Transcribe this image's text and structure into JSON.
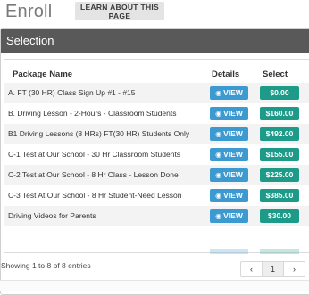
{
  "page": {
    "title": "Enroll",
    "learn_label": "LEARN ABOUT THIS PAGE"
  },
  "panel": {
    "title": "Selection"
  },
  "table": {
    "headers": {
      "name": "Package Name",
      "details": "Details",
      "select": "Select"
    },
    "view_label": "VIEW",
    "rows": [
      {
        "name": "A. FT (30 HR) Class Sign Up #1 - #15",
        "price": "$0.00"
      },
      {
        "name": "B. Driving Lesson - 2-Hours - Classroom Students",
        "price": "$160.00"
      },
      {
        "name": "B1 Driving Lessons (8 HRs) FT(30 HR) Students Only",
        "price": "$492.00"
      },
      {
        "name": "C-1 Test at Our School - 30 Hr Classroom Students",
        "price": "$155.00"
      },
      {
        "name": "C-2 Test at Our School - 8 Hr Class - Lesson Done",
        "price": "$225.00"
      },
      {
        "name": "C-3 Test At Our School - 8 Hr Student-Need Lesson",
        "price": "$385.00"
      },
      {
        "name": "Driving Videos for Parents",
        "price": "$30.00"
      }
    ]
  },
  "footer": {
    "entries_text": "Showing 1 to 8 of 8 entries"
  },
  "pager": {
    "prev": "‹",
    "current": "1",
    "next": "›"
  },
  "colors": {
    "view": "#3d9ad1",
    "price": "#1d9b88",
    "panel_header": "#595959"
  }
}
